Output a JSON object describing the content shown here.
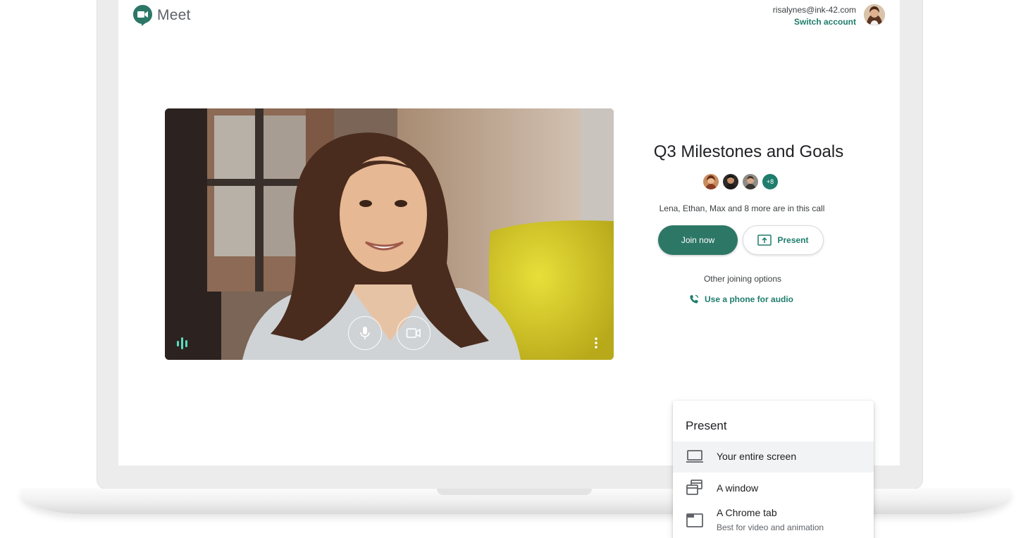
{
  "app": {
    "name": "Meet",
    "brand_color": "#2d7766",
    "link_color": "#1e7d6c"
  },
  "account": {
    "email": "risalynes@ink-42.com",
    "switch_label": "Switch account"
  },
  "preview": {
    "icons": [
      "audio-level-icon",
      "mic-icon",
      "camera-icon",
      "more-vert-icon"
    ]
  },
  "meeting": {
    "title": "Q3 Milestones and Goals",
    "extra_participants": "+8",
    "in_call_text": "Lena, Ethan, Max and 8 more are in this call",
    "join_label": "Join now",
    "present_label": "Present",
    "other_options_label": "Other joining options",
    "phone_audio_label": "Use a phone for audio"
  },
  "present_menu": {
    "title": "Present",
    "items": [
      {
        "label": "Your entire screen",
        "icon": "laptop-icon",
        "subtitle": ""
      },
      {
        "label": "A window",
        "icon": "window-icon",
        "subtitle": ""
      },
      {
        "label": "A Chrome tab",
        "icon": "chrome-tab-icon",
        "subtitle": "Best for video and animation"
      }
    ]
  }
}
